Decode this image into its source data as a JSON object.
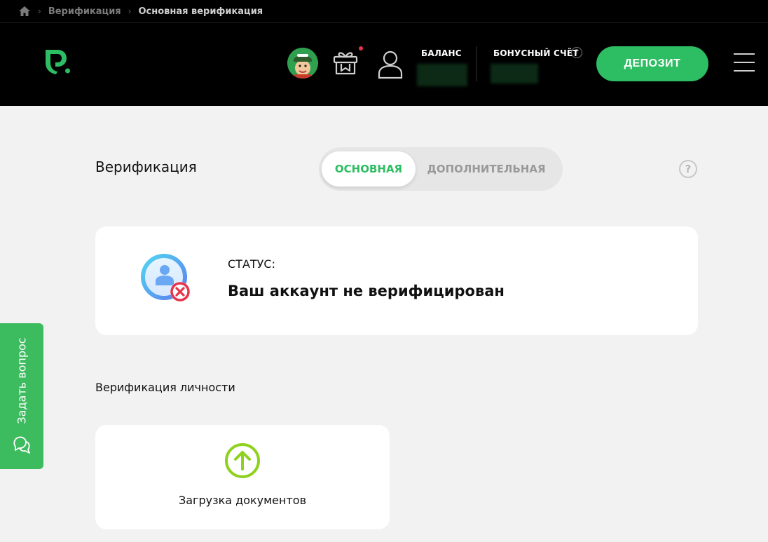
{
  "breadcrumb": {
    "home_icon": "home-icon",
    "items": [
      "Верификация",
      "Основная верификация"
    ]
  },
  "header": {
    "logo_icon": "brand-logo-icon",
    "balance_label": "БАЛАНС",
    "bonus_label": "БОНУСНЫЙ СЧЁТ",
    "bonus_help": "?",
    "deposit_label": "ДЕПОЗИТ"
  },
  "verification": {
    "title": "Верификация",
    "tabs": [
      {
        "label": "ОСНОВНАЯ",
        "active": true
      },
      {
        "label": "ДОПОЛНИТЕЛЬНАЯ",
        "active": false
      }
    ],
    "help": "?",
    "status_label": "СТАТУС:",
    "status_text": "Ваш аккаунт не верифицирован",
    "section_title": "Верификация личности",
    "upload_label": "Загрузка документов"
  },
  "support": {
    "ask_label": "Задать вопрос"
  },
  "colors": {
    "accent": "#2dbd62",
    "error": "#e8334a",
    "upload": "#8fd11f"
  }
}
